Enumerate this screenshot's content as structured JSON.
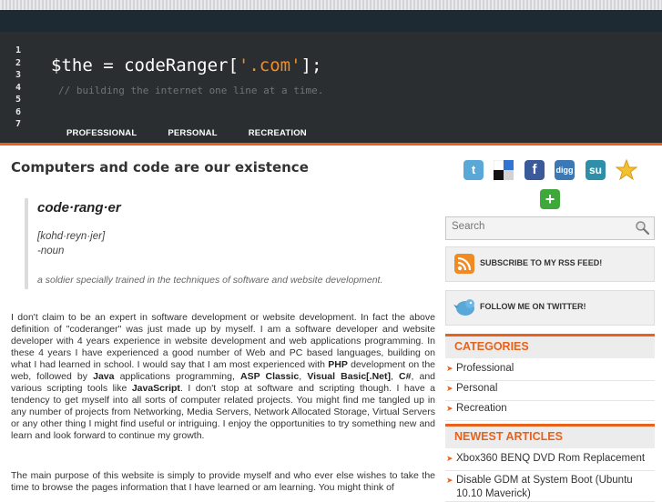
{
  "header": {
    "line_numbers": [
      "1",
      "2",
      "3",
      "4",
      "5",
      "6",
      "7"
    ],
    "code_prefix": "$the = codeRanger[",
    "code_string": "'.com'",
    "code_suffix": "];",
    "comment": "// building the internet one line at a time.",
    "nav": [
      "PROFESSIONAL",
      "PERSONAL",
      "RECREATION"
    ]
  },
  "main": {
    "title": "Computers and code are our existence",
    "definition": {
      "word": "code·rang·er",
      "pronunciation": "[kohd·reyn·jer]",
      "part_of_speech": "-noun",
      "meaning": "a soldier specially trained in the techniques of software and website development."
    },
    "p1": {
      "a": "I don't claim to be an expert in software development or website development. In fact the above definition of \"coderanger\" was just made up by myself. I am a software developer and website developer with 4 years experience in website development and web applications programming. In these 4 years I have experienced a good number of Web and PC based languages, building on what I had learned in school. I would say that I am most experienced with ",
      "b1": "PHP",
      "c": " development on the web, followed by ",
      "b2": "Java",
      "d": " applications programming, ",
      "b3": "ASP Classic",
      "e": ", ",
      "b4": "Visual Basic[.Net]",
      "f": ", ",
      "b5": "C#",
      "g": ", and various scripting tools like ",
      "b6": "JavaScript",
      "h": ". I don't stop at software and scripting though. I have a tendency to get myself into all sorts of computer related projects. You might find me tangled up in any number of projects from Networking, Media Servers, Network Allocated Storage, Virtual Servers or any other thing I might find useful or intriguing. I enjoy the opportunities to try something new and learn and look forward to continue my growth."
    },
    "p2": "The main purpose of this website is simply to provide myself and who ever else wishes to take the time to browse the pages information that I have learned or am learning. You might think of"
  },
  "sidebar": {
    "social_icons": [
      "twitter-icon",
      "delicious-icon",
      "facebook-icon",
      "digg-icon",
      "stumbleupon-icon",
      "favorite-star-icon",
      "add-icon"
    ],
    "digg_label": "digg",
    "search_placeholder": "Search",
    "rss_label": "SUBSCRIBE TO MY RSS FEED!",
    "twitter_label": "FOLLOW ME ON TWITTER!",
    "categories_title": "CATEGORIES",
    "categories": [
      "Professional",
      "Personal",
      "Recreation"
    ],
    "newest_title": "NEWEST ARTICLES",
    "newest": [
      "Xbox360 BENQ DVD Rom Replacement",
      "Disable GDM at System Boot (Ubuntu 10.10 Maverick)"
    ]
  },
  "colors": {
    "accent": "#e8621b",
    "header_bg": "#2a2e31"
  }
}
